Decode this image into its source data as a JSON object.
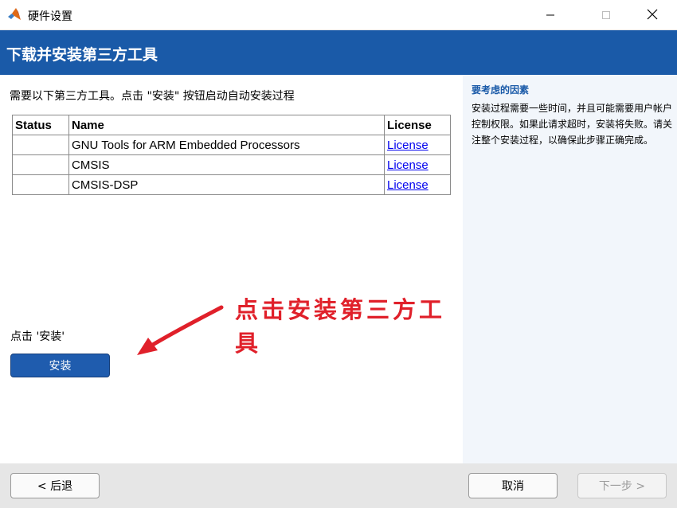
{
  "window": {
    "title": "硬件设置"
  },
  "banner": {
    "title": "下载并安装第三方工具"
  },
  "main": {
    "instructions": "需要以下第三方工具。点击 \"安装\" 按钮启动自动安装过程",
    "table": {
      "headers": [
        "Status",
        "Name",
        "License"
      ],
      "rows": [
        {
          "status": "",
          "name": "GNU Tools for ARM Embedded Processors",
          "license": "License"
        },
        {
          "status": "",
          "name": "CMSIS",
          "license": "License"
        },
        {
          "status": "",
          "name": "CMSIS-DSP",
          "license": "License"
        }
      ]
    },
    "click_hint": "点击 '安装'",
    "install_label": "安装",
    "annotation": "点击安装第三方工具"
  },
  "side": {
    "title": "要考虑的因素",
    "text": "安装过程需要一些时间，并且可能需要用户帐户控制权限。如果此请求超时，安装将失败。请关注整个安装过程，以确保此步骤正确完成。"
  },
  "footer": {
    "back_label": "< 后退",
    "cancel_label": "取消",
    "next_label": "下一步 >"
  },
  "colors": {
    "banner": "#1a5aa8",
    "side_panel": "#f2f6fb",
    "annotation": "#e0202a",
    "install_button": "#1f5cae"
  },
  "icons": [
    "matlab-logo-icon",
    "minimize-icon",
    "maximize-icon",
    "close-icon",
    "arrow-icon"
  ]
}
